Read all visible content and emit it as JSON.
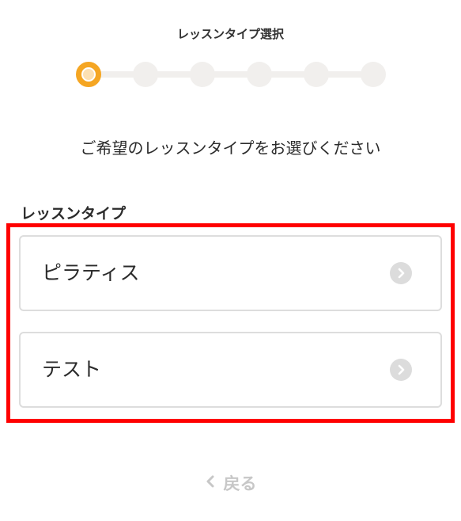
{
  "header": {
    "step_title": "レッスンタイプ選択"
  },
  "stepper": {
    "total_steps": 6,
    "current_step": 1,
    "active_color": "#f5a623",
    "inactive_color": "#f1efed"
  },
  "main": {
    "instruction": "ご希望のレッスンタイプをお選びください",
    "section_label": "レッスンタイプ",
    "options": [
      {
        "label": "ピラティス",
        "icon": "chevron-right-icon"
      },
      {
        "label": "テスト",
        "icon": "chevron-right-icon"
      }
    ],
    "highlight_color": "#ff0000"
  },
  "footer": {
    "back_label": "戻る",
    "back_icon": "chevron-left-icon"
  }
}
